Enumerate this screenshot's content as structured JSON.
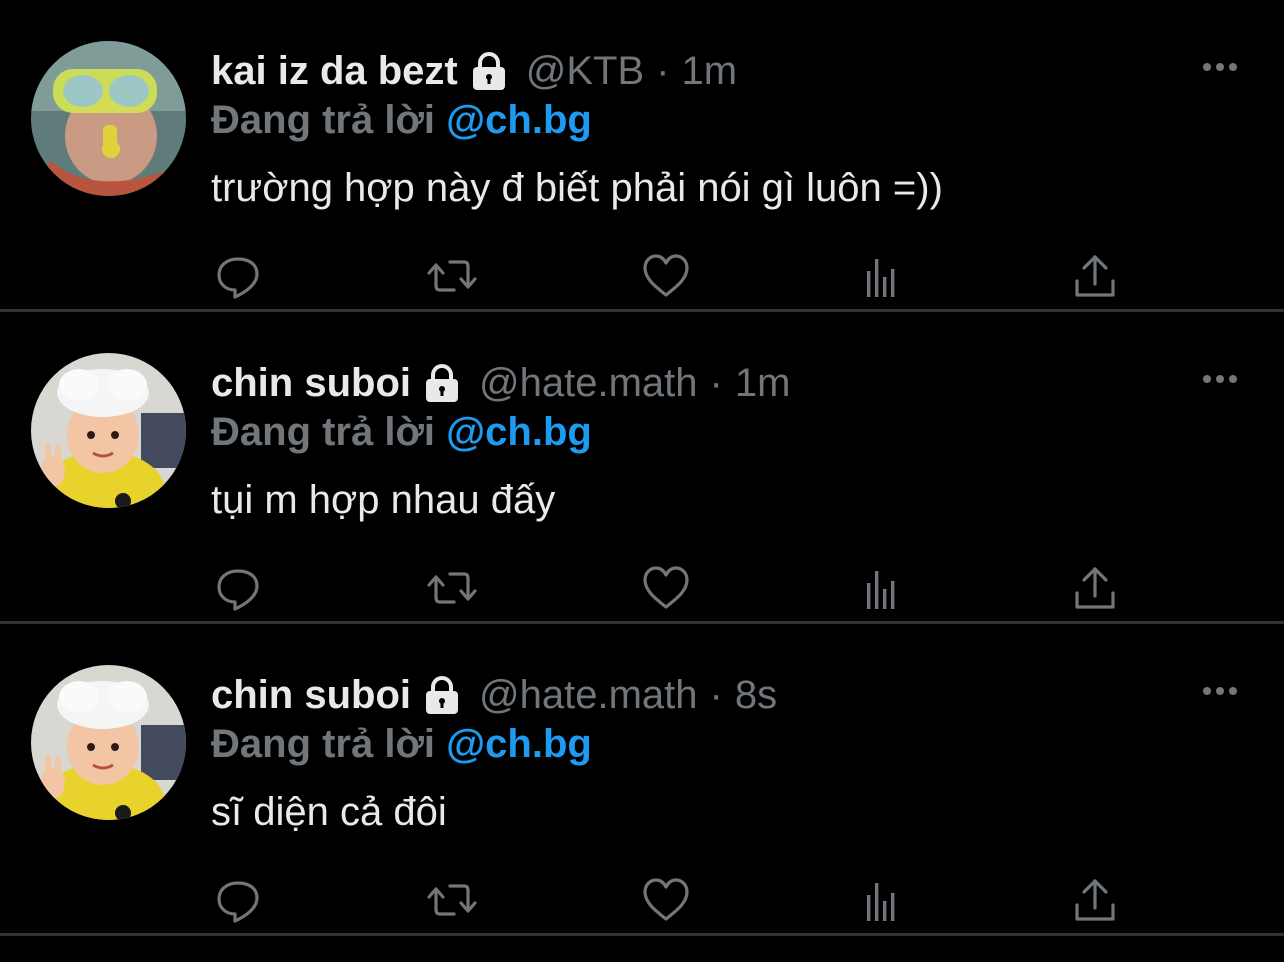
{
  "colors": {
    "background": "#000000",
    "divider": "#2f3336",
    "primary_text": "#e7e9ea",
    "secondary_text": "#71767b",
    "accent": "#1d9bf0"
  },
  "tweets": [
    {
      "display_name": "kai iz da bezt",
      "protected_icon": "lock-icon",
      "handle": "@KTB",
      "separator": "·",
      "time": "1m",
      "reply_prefix": "Đang trả lời ",
      "reply_to": "@ch.bg",
      "text": "trường hợp này đ biết phải nói gì luôn =))",
      "avatar": "snorkel-mask-avatar"
    },
    {
      "display_name": "chin suboi",
      "protected_icon": "lock-icon",
      "handle": "@hate.math",
      "separator": "·",
      "time": "1m",
      "reply_prefix": "Đang trả lời ",
      "reply_to": "@ch.bg",
      "text": "tụi m hợp nhau đấy",
      "avatar": "child-chef-hat-avatar"
    },
    {
      "display_name": "chin suboi",
      "protected_icon": "lock-icon",
      "handle": "@hate.math",
      "separator": "·",
      "time": "8s",
      "reply_prefix": "Đang trả lời ",
      "reply_to": "@ch.bg",
      "text": "sĩ diện cả đôi",
      "avatar": "child-chef-hat-avatar"
    }
  ],
  "action_icons": [
    "reply-icon",
    "retweet-icon",
    "like-icon",
    "analytics-icon",
    "share-icon"
  ]
}
